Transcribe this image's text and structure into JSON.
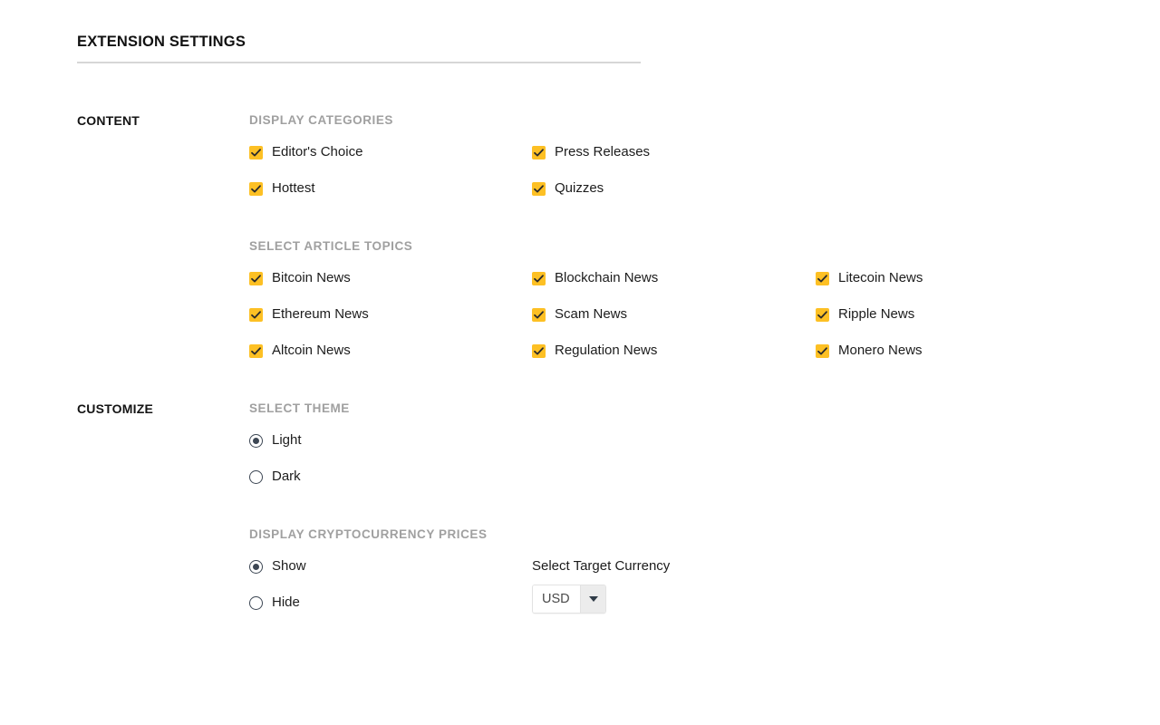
{
  "header": {
    "title": "EXTENSION SETTINGS"
  },
  "sections": {
    "content": {
      "label": "CONTENT",
      "display_categories": {
        "title": "DISPLAY CATEGORIES",
        "items": [
          {
            "label": "Editor's Choice",
            "checked": true
          },
          {
            "label": "Press Releases",
            "checked": true
          },
          {
            "label": "Hottest",
            "checked": true
          },
          {
            "label": "Quizzes",
            "checked": true
          }
        ]
      },
      "article_topics": {
        "title": "SELECT ARTICLE TOPICS",
        "items": [
          {
            "label": "Bitcoin News",
            "checked": true
          },
          {
            "label": "Blockchain News",
            "checked": true
          },
          {
            "label": "Litecoin News",
            "checked": true
          },
          {
            "label": "Ethereum News",
            "checked": true
          },
          {
            "label": "Scam News",
            "checked": true
          },
          {
            "label": "Ripple News",
            "checked": true
          },
          {
            "label": "Altcoin News",
            "checked": true
          },
          {
            "label": "Regulation News",
            "checked": true
          },
          {
            "label": "Monero News",
            "checked": true
          }
        ]
      }
    },
    "customize": {
      "label": "CUSTOMIZE",
      "select_theme": {
        "title": "SELECT THEME",
        "options": [
          {
            "label": "Light",
            "selected": true
          },
          {
            "label": "Dark",
            "selected": false
          }
        ]
      },
      "crypto_prices": {
        "title": "DISPLAY CRYPTOCURRENCY PRICES",
        "options": [
          {
            "label": "Show",
            "selected": true
          },
          {
            "label": "Hide",
            "selected": false
          }
        ],
        "currency_select": {
          "caption": "Select Target Currency",
          "value": "USD",
          "options": [
            "USD"
          ]
        }
      }
    }
  },
  "colors": {
    "checkbox_fill": "#fdc024",
    "radio_stroke": "#3c4653",
    "group_title": "#a0a0a0",
    "rule": "#d6d6d6",
    "text": "#1c1c1c"
  }
}
